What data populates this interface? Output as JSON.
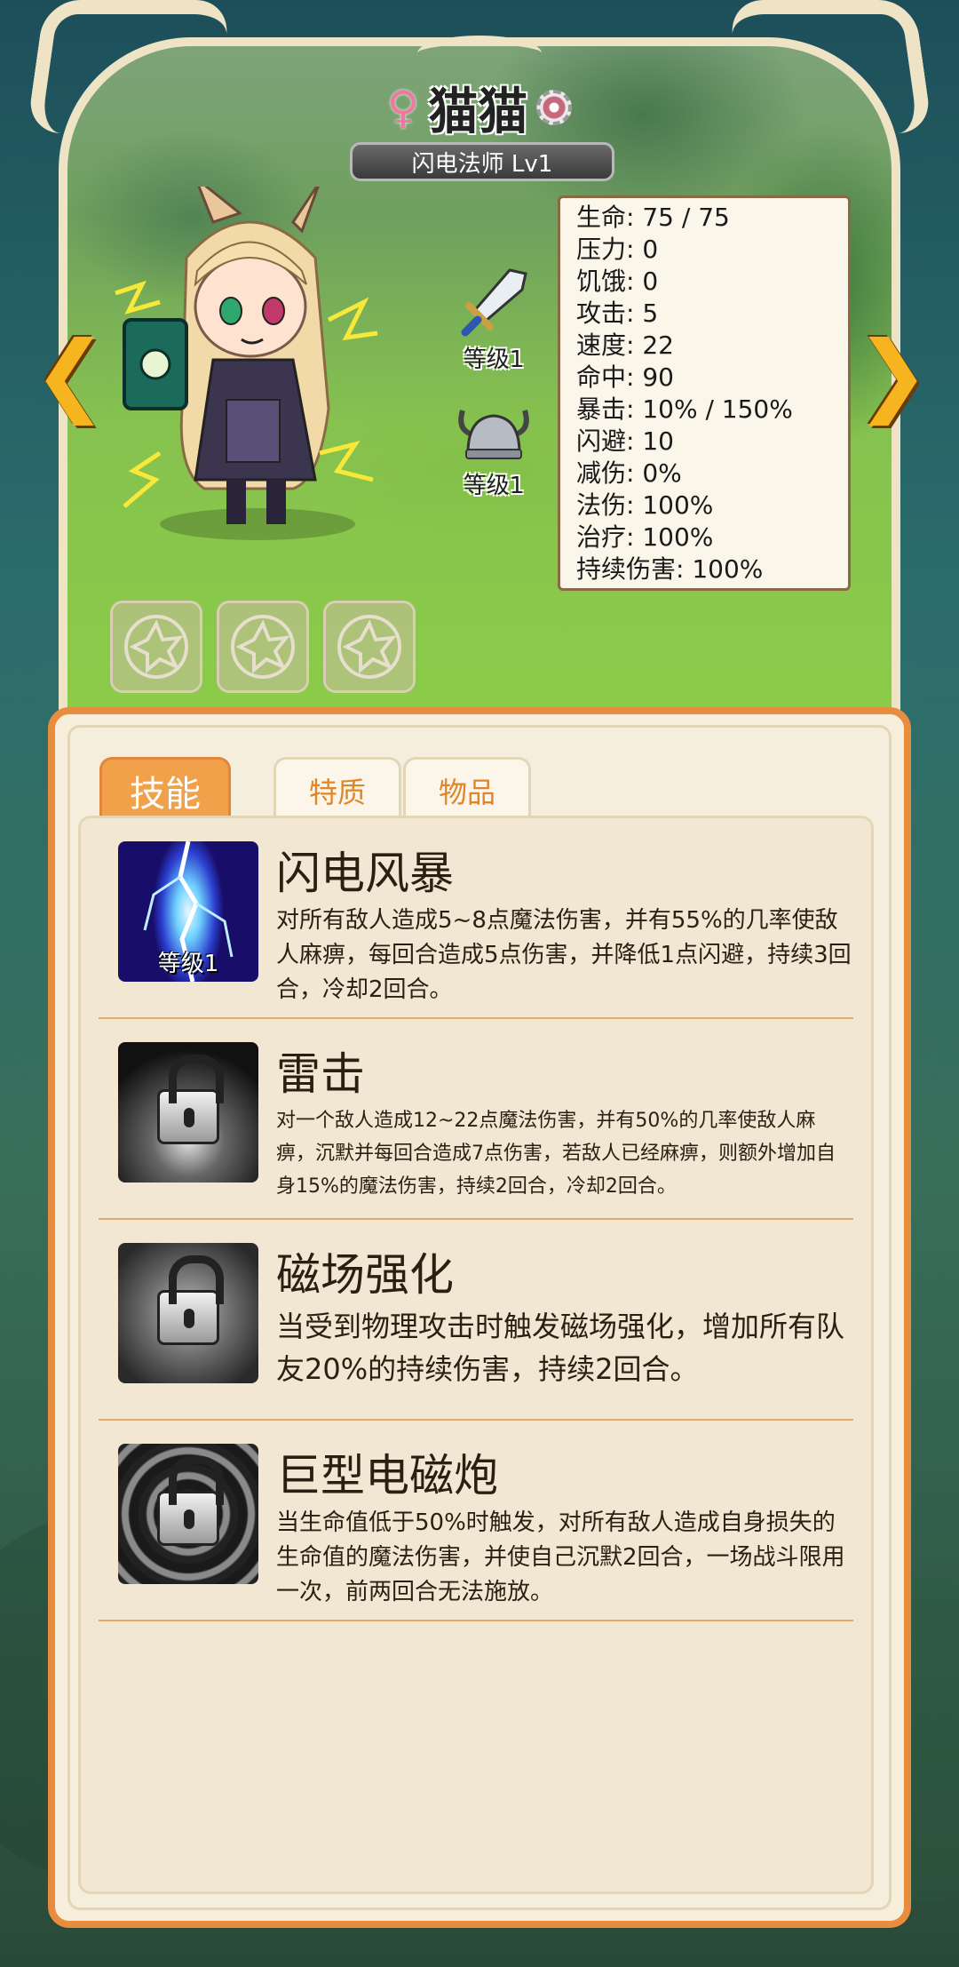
{
  "hero": {
    "gender_icon": "♀",
    "name": "猫猫",
    "class_level": "闪电法师 Lv1",
    "nav_prev": "❮",
    "nav_next": "❯"
  },
  "equipment": [
    {
      "name": "sword",
      "level": "等级1"
    },
    {
      "name": "helmet",
      "level": "等级1"
    }
  ],
  "stats": [
    "生命: 75 / 75",
    "压力: 0",
    "饥饿: 0",
    "攻击: 5",
    "速度: 22",
    "命中: 90",
    "暴击: 10% / 150%",
    "闪避: 10",
    "减伤: 0%",
    "法伤: 100%",
    "治疗: 100%",
    "持续伤害: 100%"
  ],
  "tabs": {
    "skills": "技能",
    "traits": "特质",
    "items": "物品"
  },
  "skills": [
    {
      "title": "闪电风暴",
      "level": "等级1",
      "locked": false,
      "desc": "对所有敌人造成5~8点魔法伤害，并有55%的几率使敌人麻痹，每回合造成5点伤害，并降低1点闪避，持续3回合，冷却2回合。"
    },
    {
      "title": "雷击",
      "locked": true,
      "desc": "对一个敌人造成12~22点魔法伤害，并有50%的几率使敌人麻痹，沉默并每回合造成7点伤害，若敌人已经麻痹，则额外增加自身15%的魔法伤害，持续2回合，冷却2回合。"
    },
    {
      "title": "磁场强化",
      "locked": true,
      "desc": "当受到物理攻击时触发磁场强化，增加所有队友20%的持续伤害，持续2回合。"
    },
    {
      "title": "巨型电磁炮",
      "locked": true,
      "desc": "当生命值低于50%时触发，对所有敌人造成自身损失的生命值的魔法伤害，并使自己沉默2回合，一场战斗限用一次，前两回合无法施放。"
    }
  ],
  "colors": {
    "accent_orange": "#e88d3f",
    "tab_active": "#f2a14b",
    "tab_inactive_text": "#e0862a",
    "panel_bg": "#f7efdc",
    "grass_green": "#8ccc48"
  }
}
